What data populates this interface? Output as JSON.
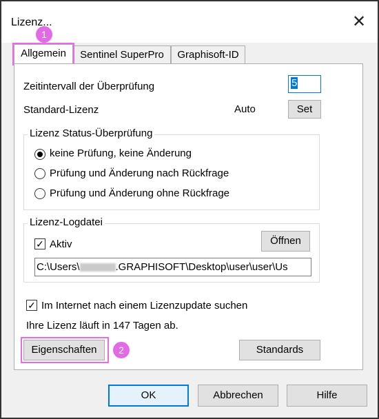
{
  "window": {
    "title": "Lizenz...",
    "close_glyph": "✕"
  },
  "tabs": [
    {
      "label": "Allgemein",
      "active": true
    },
    {
      "label": "Sentinel SuperPro",
      "active": false
    },
    {
      "label": "Graphisoft-ID",
      "active": false
    }
  ],
  "annotations": {
    "badge1": "1",
    "badge2": "2",
    "color": "#e86ae8"
  },
  "general": {
    "interval_label": "Zeitintervall der Überprüfung",
    "interval_value": "5",
    "standard_license_label": "Standard-Lizenz",
    "standard_license_value": "Auto",
    "set_button": "Set"
  },
  "status_group": {
    "title": "Lizenz Status-Überprüfung",
    "options": [
      {
        "label": "keine Prüfung, keine Änderung",
        "selected": true
      },
      {
        "label": "Prüfung und Änderung nach Rückfrage",
        "selected": false
      },
      {
        "label": "Prüfung und Änderung ohne Rückfrage",
        "selected": false
      }
    ]
  },
  "logfile_group": {
    "title": "Lizenz-Logdatei",
    "active_label": "Aktiv",
    "active_checked": true,
    "open_button": "Öffnen",
    "path_prefix": "C:\\Users\\",
    "path_suffix": ".GRAPHISOFT\\Desktop\\user\\user\\Us"
  },
  "internet_update": {
    "label": "Im Internet nach einem Lizenzupdate suchen",
    "checked": true
  },
  "expiry_text": "Ihre Lizenz läuft in 147 Tagen ab.",
  "buttons": {
    "properties": "Eigenschaften",
    "standards": "Standards",
    "ok": "OK",
    "cancel": "Abbrechen",
    "help": "Hilfe"
  }
}
